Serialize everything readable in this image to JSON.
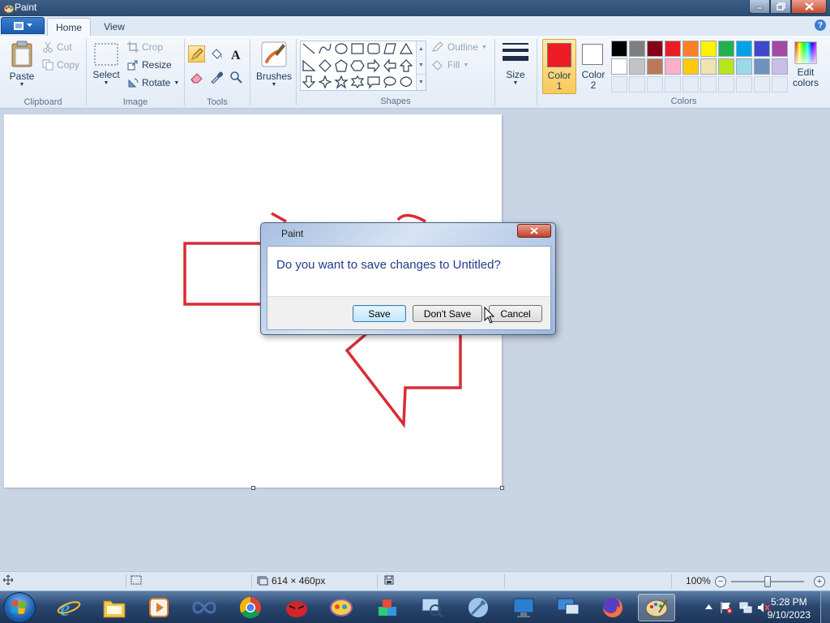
{
  "window": {
    "title": "Paint"
  },
  "tabs": {
    "home": "Home",
    "view": "View"
  },
  "ribbon": {
    "clipboard": {
      "label": "Clipboard",
      "paste": "Paste",
      "cut": "Cut",
      "copy": "Copy"
    },
    "image": {
      "label": "Image",
      "select": "Select",
      "crop": "Crop",
      "resize": "Resize",
      "rotate": "Rotate"
    },
    "tools": {
      "label": "Tools"
    },
    "brushes": {
      "label": "Brushes"
    },
    "shapes": {
      "label": "Shapes",
      "outline": "Outline",
      "fill": "Fill"
    },
    "size": {
      "label": "Size"
    },
    "color1": {
      "label_line1": "Color",
      "label_line2": "1",
      "value": "#ed1c24"
    },
    "color2": {
      "label_line1": "Color",
      "label_line2": "2",
      "value": "#ffffff"
    },
    "colors": {
      "label": "Colors",
      "edit_line1": "Edit",
      "edit_line2": "colors"
    },
    "palette_row1": [
      "#000000",
      "#7f7f7f",
      "#880015",
      "#ed1c24",
      "#ff7f27",
      "#fff200",
      "#22b14c",
      "#00a2e8",
      "#3f48cc",
      "#a349a4"
    ],
    "palette_row2": [
      "#ffffff",
      "#c3c3c3",
      "#b97a57",
      "#ffaec9",
      "#ffc90e",
      "#efe4b0",
      "#b5e61d",
      "#99d9ea",
      "#7092be",
      "#c8bfe7"
    ]
  },
  "dialog": {
    "title": "Paint",
    "message": "Do you want to save changes to Untitled?",
    "save": "Save",
    "dont_save": "Don't Save",
    "cancel": "Cancel"
  },
  "statusbar": {
    "image_size": "614 × 460px",
    "zoom": "100%",
    "zoom_fraction": 0.5
  },
  "taskbar": {
    "time": "5:28 PM",
    "date": "9/10/2023"
  },
  "colors": {
    "accent_red": "#ed1c24",
    "drawing_stroke": "#d92c34"
  }
}
